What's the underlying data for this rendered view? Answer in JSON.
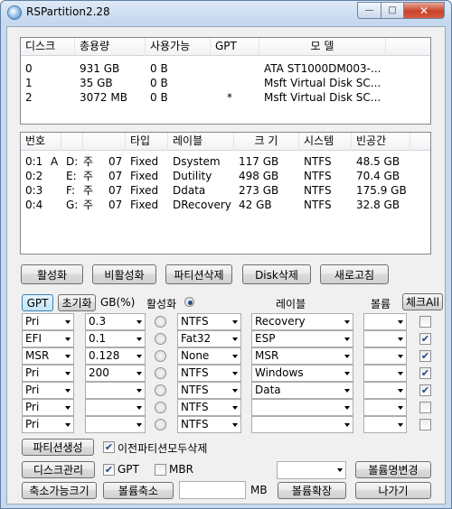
{
  "window": {
    "title": "RSPartition2.28",
    "min": "—",
    "max": "□",
    "close": "✕"
  },
  "disks": {
    "headers": [
      "디스크",
      "총용량",
      "사용가능",
      "GPT",
      "모    델"
    ],
    "rows": [
      [
        "0",
        "931 GB",
        "0 B",
        "",
        "ATA ST1000DM003-..."
      ],
      [
        "1",
        "35 GB",
        "0 B",
        "",
        "Msft Virtual Disk SC..."
      ],
      [
        "2",
        "3072 MB",
        "0 B",
        "*",
        "Msft Virtual Disk SC..."
      ]
    ]
  },
  "partitions": {
    "headers": [
      "번호",
      "",
      "",
      "타입",
      "레이블",
      "크 기",
      "시스템",
      "빈공간"
    ],
    "rows": [
      [
        "0:1",
        "A",
        "D:",
        "주",
        "07",
        "Fixed",
        "Dsystem",
        "117 GB",
        "NTFS",
        "48.5 GB"
      ],
      [
        "0:2",
        "",
        "E:",
        "주",
        "07",
        "Fixed",
        "Dutility",
        "498 GB",
        "NTFS",
        "70.4 GB"
      ],
      [
        "0:3",
        "",
        "F:",
        "주",
        "07",
        "Fixed",
        "Ddata",
        "273 GB",
        "NTFS",
        "175.9 GB"
      ],
      [
        "0:4",
        "",
        "G:",
        "주",
        "07",
        "Fixed",
        "DRecovery",
        "42 GB",
        "NTFS",
        "32.8 GB"
      ]
    ]
  },
  "actions": {
    "activate": "활성화",
    "deactivate": "비활성화",
    "delete_partition": "파티션삭제",
    "delete_disk": "Disk삭제",
    "refresh": "새로고침"
  },
  "layout_header": {
    "gpt": "GPT",
    "reset": "초기화",
    "gb_pct": "GB(%)",
    "active": "활성화",
    "label": "레이블",
    "volume": "볼륨",
    "check_all": "체크All"
  },
  "layout_rows": [
    {
      "type": "Pri",
      "size": "0.3",
      "active": false,
      "fs": "NTFS",
      "label": "Recovery",
      "volume": "",
      "checked": false
    },
    {
      "type": "EFI",
      "size": "0.1",
      "active": false,
      "fs": "Fat32",
      "label": "ESP",
      "volume": "",
      "checked": true
    },
    {
      "type": "MSR",
      "size": "0.128",
      "active": false,
      "fs": "None",
      "label": "MSR",
      "volume": "",
      "checked": true
    },
    {
      "type": "Pri",
      "size": "200",
      "active": false,
      "fs": "NTFS",
      "label": "Windows",
      "volume": "",
      "checked": true
    },
    {
      "type": "Pri",
      "size": "",
      "active": false,
      "fs": "NTFS",
      "label": "Data",
      "volume": "",
      "checked": true
    },
    {
      "type": "Pri",
      "size": "",
      "active": false,
      "fs": "NTFS",
      "label": "",
      "volume": "",
      "checked": false
    },
    {
      "type": "Pri",
      "size": "",
      "active": false,
      "fs": "NTFS",
      "label": "",
      "volume": "",
      "checked": false
    }
  ],
  "bottom": {
    "create_partition": "파티션생성",
    "delete_prev_label": "이전파티션모두삭제",
    "delete_prev_checked": true,
    "disk_manage": "디스크관리",
    "gpt_label": "GPT",
    "gpt_checked": true,
    "mbr_label": "MBR",
    "mbr_checked": false,
    "drive_select": "",
    "rename_volume": "볼륨명변경",
    "shrinkable": "축소가능크기",
    "shrink_volume": "볼륨축소",
    "size_value": "",
    "unit": "MB",
    "extend_volume": "볼륨확장",
    "exit": "나가기"
  },
  "icons": {
    "app": "app-icon",
    "check_mark": "✔"
  }
}
